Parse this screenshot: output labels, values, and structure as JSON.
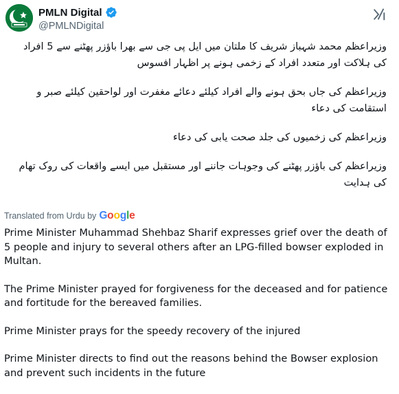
{
  "author": {
    "display_name": "PMLN Digital",
    "handle": "@PMLNDigital",
    "verified": true,
    "avatar_color": "#0a7a3a"
  },
  "icons": {
    "verified": "verified-badge-icon",
    "grok": "grok-icon"
  },
  "colors": {
    "verified_blue": "#1d9bf0",
    "secondary_text": "#536471",
    "google_blue": "#4285f4",
    "google_red": "#ea4335",
    "google_yellow": "#fbbc05",
    "google_green": "#34a853"
  },
  "original_text": {
    "language": "Urdu",
    "paragraphs": [
      "وزیراعظم محمد شہباز شریف کا ملتان میں ایل پی جی سے بھرا باؤزر پھٹنے سے 5 افراد کی ہلاکت اور متعدد افراد کے زخمی ہونے پر اظہار افسوس",
      "وزیراعظم کی جاں بحق ہونے والے افراد کیلئے دعائے مغفرت اور لواحقین کیلئے صبر و استقامت کی دعاء",
      "وزیراعظم کی زخمیوں کی جلد صحت یابی کی دعاء",
      "وزیراعظم کی باؤزر پھٹنے کی وجوہات جاننے اور مستقبل میں ایسے واقعات کی روک تھام کی ہدایت"
    ]
  },
  "translation": {
    "label": "Translated from Urdu by",
    "provider": "Google",
    "paragraphs": [
      "Prime Minister Muhammad Shehbaz Sharif expresses grief over the death of 5 people and injury to several others after an LPG-filled bowser exploded in Multan.",
      "The Prime Minister prayed for forgiveness for the deceased and for patience and fortitude for the bereaved families.",
      "Prime Minister prays for the speedy recovery of the injured",
      "Prime Minister directs to find out the reasons behind the Bowser explosion and prevent such incidents in the future"
    ]
  }
}
